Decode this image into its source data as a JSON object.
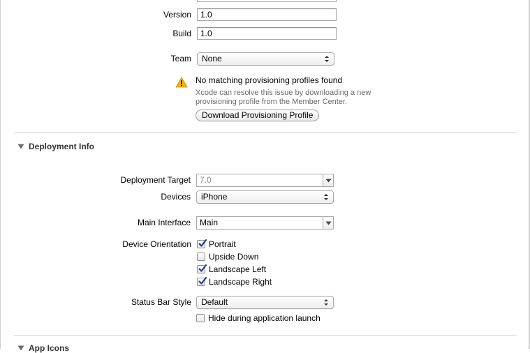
{
  "identity": {
    "version_label": "Version",
    "version_value": "1.0",
    "build_label": "Build",
    "build_value": "1.0",
    "team_label": "Team",
    "team_value": "None"
  },
  "warning": {
    "icon": "warning-triangle-icon",
    "title": "No matching provisioning profiles found",
    "message": "Xcode can resolve this issue by downloading a new provisioning profile from the Member Center.",
    "button_label": "Download Provisioning Profile"
  },
  "deployment": {
    "section_title": "Deployment Info",
    "target_label": "Deployment Target",
    "target_value": "7.0",
    "devices_label": "Devices",
    "devices_value": "iPhone",
    "main_interface_label": "Main Interface",
    "main_interface_value": "Main",
    "orientation_label": "Device Orientation",
    "orientations": [
      {
        "label": "Portrait",
        "checked": true
      },
      {
        "label": "Upside Down",
        "checked": false
      },
      {
        "label": "Landscape Left",
        "checked": true
      },
      {
        "label": "Landscape Right",
        "checked": true
      }
    ],
    "status_bar_label": "Status Bar Style",
    "status_bar_value": "Default",
    "hide_status_label": "Hide during application launch",
    "hide_status_checked": false
  },
  "next_section": {
    "title": "App Icons"
  },
  "colors": {
    "warning": "#f5b400",
    "check": "#1f3f8f"
  }
}
